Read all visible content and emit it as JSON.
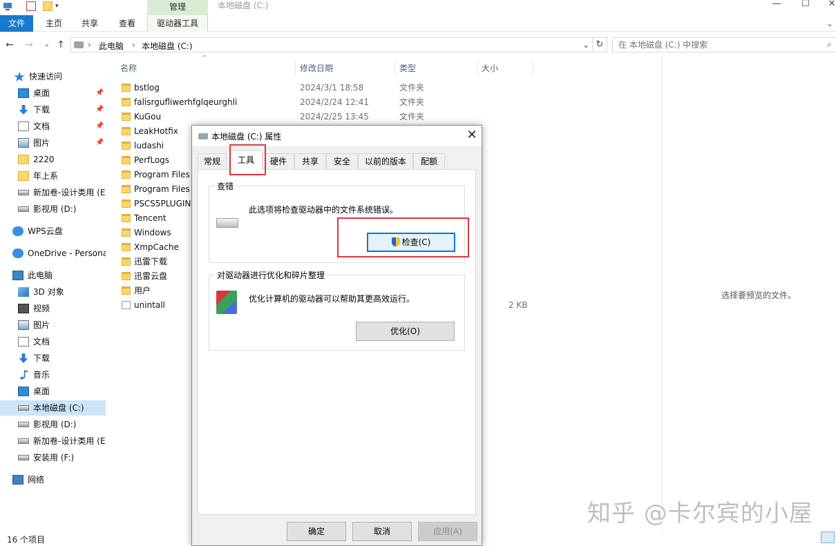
{
  "window": {
    "title": "本地磁盘 (C:)",
    "context_tab": "管理",
    "controls": [
      "—",
      "☐",
      "✕"
    ]
  },
  "ribbon": {
    "tabs": [
      "文件",
      "主页",
      "共享",
      "查看",
      "驱动器工具"
    ],
    "expand_icon": "chevron-down-icon"
  },
  "address": {
    "segments": [
      "此电脑",
      "本地磁盘 (C:)"
    ],
    "search_placeholder": "在 本地磁盘 (C:) 中搜索"
  },
  "sidebar": {
    "items": [
      {
        "label": "快速访问",
        "icon": "star-icon",
        "pinned": false
      },
      {
        "label": "桌面",
        "icon": "desktop-icon",
        "pinned": true
      },
      {
        "label": "下载",
        "icon": "download-icon",
        "pinned": true
      },
      {
        "label": "文档",
        "icon": "document-icon",
        "pinned": true
      },
      {
        "label": "图片",
        "icon": "picture-icon",
        "pinned": true
      },
      {
        "label": "2220",
        "icon": "folder-icon",
        "pinned": false
      },
      {
        "label": "年上系",
        "icon": "folder-icon",
        "pinned": false
      },
      {
        "label": "新加卷-设计类用 (E",
        "icon": "drive-icon",
        "pinned": false
      },
      {
        "label": "影视用 (D:)",
        "icon": "drive-icon",
        "pinned": false
      },
      {
        "label": "WPS云盘",
        "icon": "cloud-icon",
        "pinned": false
      },
      {
        "label": "OneDrive - Persona",
        "icon": "cloud-icon",
        "pinned": false
      },
      {
        "label": "此电脑",
        "icon": "computer-icon",
        "pinned": false
      },
      {
        "label": "3D 对象",
        "icon": "cube-icon",
        "pinned": false
      },
      {
        "label": "视频",
        "icon": "video-icon",
        "pinned": false
      },
      {
        "label": "图片",
        "icon": "picture-icon",
        "pinned": false
      },
      {
        "label": "文档",
        "icon": "document-icon",
        "pinned": false
      },
      {
        "label": "下载",
        "icon": "download-icon",
        "pinned": false
      },
      {
        "label": "音乐",
        "icon": "music-icon",
        "pinned": false
      },
      {
        "label": "桌面",
        "icon": "desktop-icon",
        "pinned": false
      },
      {
        "label": "本地磁盘 (C:)",
        "icon": "drive-icon",
        "pinned": false,
        "selected": true
      },
      {
        "label": "影视用 (D:)",
        "icon": "drive-icon",
        "pinned": false
      },
      {
        "label": "新加卷-设计类用 (E",
        "icon": "drive-icon",
        "pinned": false
      },
      {
        "label": "安装用 (F:)",
        "icon": "drive-icon",
        "pinned": false
      },
      {
        "label": "网络",
        "icon": "network-icon",
        "pinned": false
      }
    ]
  },
  "filelist": {
    "columns": [
      "名称",
      "修改日期",
      "类型",
      "大小"
    ],
    "rows": [
      {
        "name": "bstlog",
        "date": "2024/3/1 18:58",
        "type": "文件夹",
        "size": ""
      },
      {
        "name": "falisrgufliwerhfglqeurghli",
        "date": "2024/2/24 12:41",
        "type": "文件夹",
        "size": ""
      },
      {
        "name": "KuGou",
        "date": "2024/2/25 13:45",
        "type": "文件夹",
        "size": ""
      },
      {
        "name": "LeakHotfix",
        "date": "",
        "type": "",
        "size": ""
      },
      {
        "name": "ludashi",
        "date": "",
        "type": "",
        "size": ""
      },
      {
        "name": "PerfLogs",
        "date": "",
        "type": "",
        "size": ""
      },
      {
        "name": "Program Files",
        "date": "",
        "type": "",
        "size": ""
      },
      {
        "name": "Program Files",
        "date": "",
        "type": "",
        "size": ""
      },
      {
        "name": "PSCS5PLUGINI",
        "date": "",
        "type": "",
        "size": ""
      },
      {
        "name": "Tencent",
        "date": "",
        "type": "",
        "size": ""
      },
      {
        "name": "Windows",
        "date": "",
        "type": "",
        "size": ""
      },
      {
        "name": "XmpCache",
        "date": "",
        "type": "",
        "size": ""
      },
      {
        "name": "迅雷下载",
        "date": "",
        "type": "",
        "size": ""
      },
      {
        "name": "迅雷云盘",
        "date": "",
        "type": "",
        "size": ""
      },
      {
        "name": "用户",
        "date": "",
        "type": "",
        "size": ""
      },
      {
        "name": "unintall",
        "date": "",
        "type": "",
        "size": "2 KB",
        "is_file": true
      }
    ]
  },
  "preview": {
    "message": "选择要预览的文件。"
  },
  "status": {
    "count": "16 个项目"
  },
  "watermark": "知乎 @卡尔宾的小屋",
  "dialog": {
    "title": "本地磁盘 (C:) 属性",
    "tabs": [
      "常规",
      "工具",
      "硬件",
      "共享",
      "安全",
      "以前的版本",
      "配额"
    ],
    "active_tab": "工具",
    "error_check": {
      "group_label": "查错",
      "description": "此选项将检查驱动器中的文件系统错误。",
      "button": "检查(C)"
    },
    "optimize": {
      "group_label": "对驱动器进行优化和碎片整理",
      "description": "优化计算机的驱动器可以帮助其更高效运行。",
      "button": "优化(O)"
    },
    "footer_buttons": {
      "ok": "确定",
      "cancel": "取消",
      "apply": "应用(A)"
    }
  },
  "colors": {
    "accent": "#1979ca",
    "manage_tab_bg": "#d9ecd5",
    "selection": "#cce4f7",
    "highlight_box": "#e0343d",
    "focus_border": "#0078d7"
  }
}
